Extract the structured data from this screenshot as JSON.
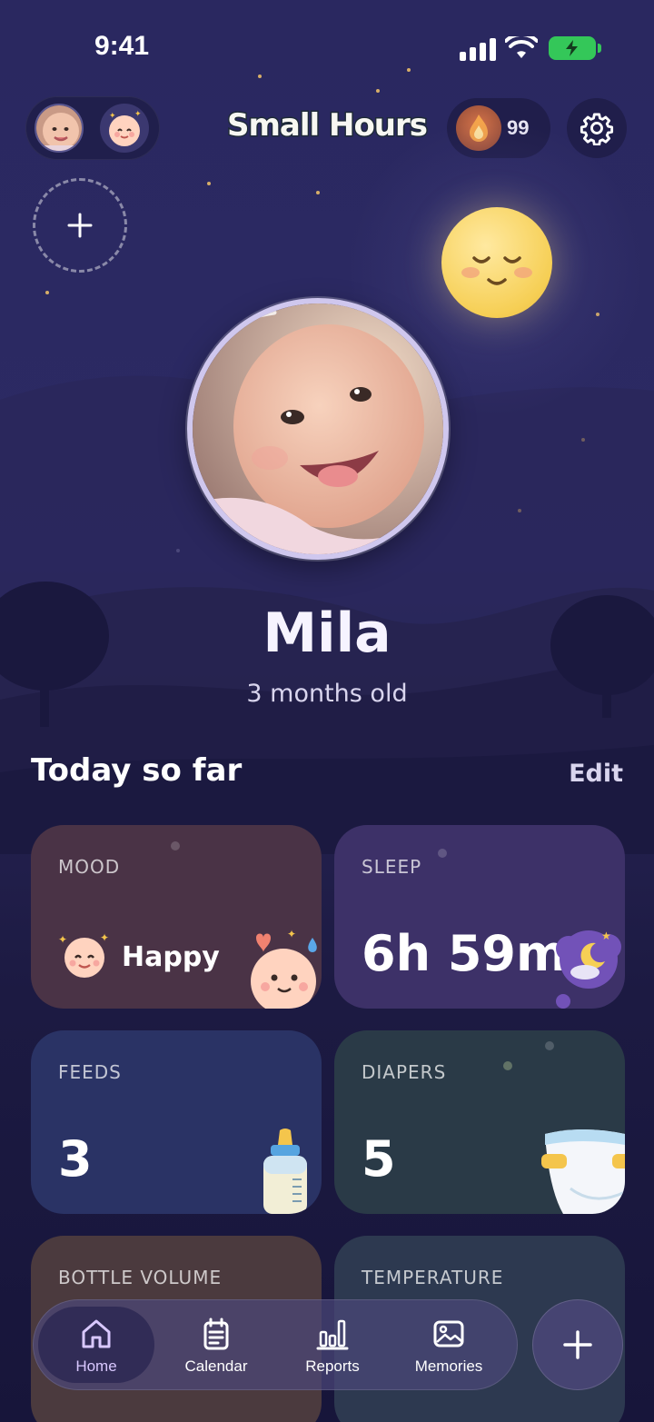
{
  "status_bar": {
    "time": "9:41"
  },
  "header": {
    "app_title": "Small Hours",
    "streak_count": "99"
  },
  "hero": {
    "name": "Mila",
    "age": "3 months old"
  },
  "section": {
    "title": "Today so far",
    "edit_label": "Edit"
  },
  "cards": {
    "mood": {
      "label": "MOOD",
      "value": "Happy"
    },
    "sleep": {
      "label": "SLEEP",
      "value": "6h 59m"
    },
    "feeds": {
      "label": "FEEDS",
      "value": "3"
    },
    "diapers": {
      "label": "DIAPERS",
      "value": "5"
    },
    "bottle": {
      "label": "BOTTLE VOLUME"
    },
    "temperature": {
      "label": "TEMPERATURE"
    }
  },
  "nav": {
    "items": [
      {
        "label": "Home",
        "icon": "home-icon",
        "active": true
      },
      {
        "label": "Calendar",
        "icon": "calendar-icon",
        "active": false
      },
      {
        "label": "Reports",
        "icon": "reports-icon",
        "active": false
      },
      {
        "label": "Memories",
        "icon": "memories-icon",
        "active": false
      }
    ]
  },
  "colors": {
    "background": "#2a2860",
    "accent": "#d9c8ff",
    "moon": "#f6cf55",
    "battery": "#34c759"
  }
}
